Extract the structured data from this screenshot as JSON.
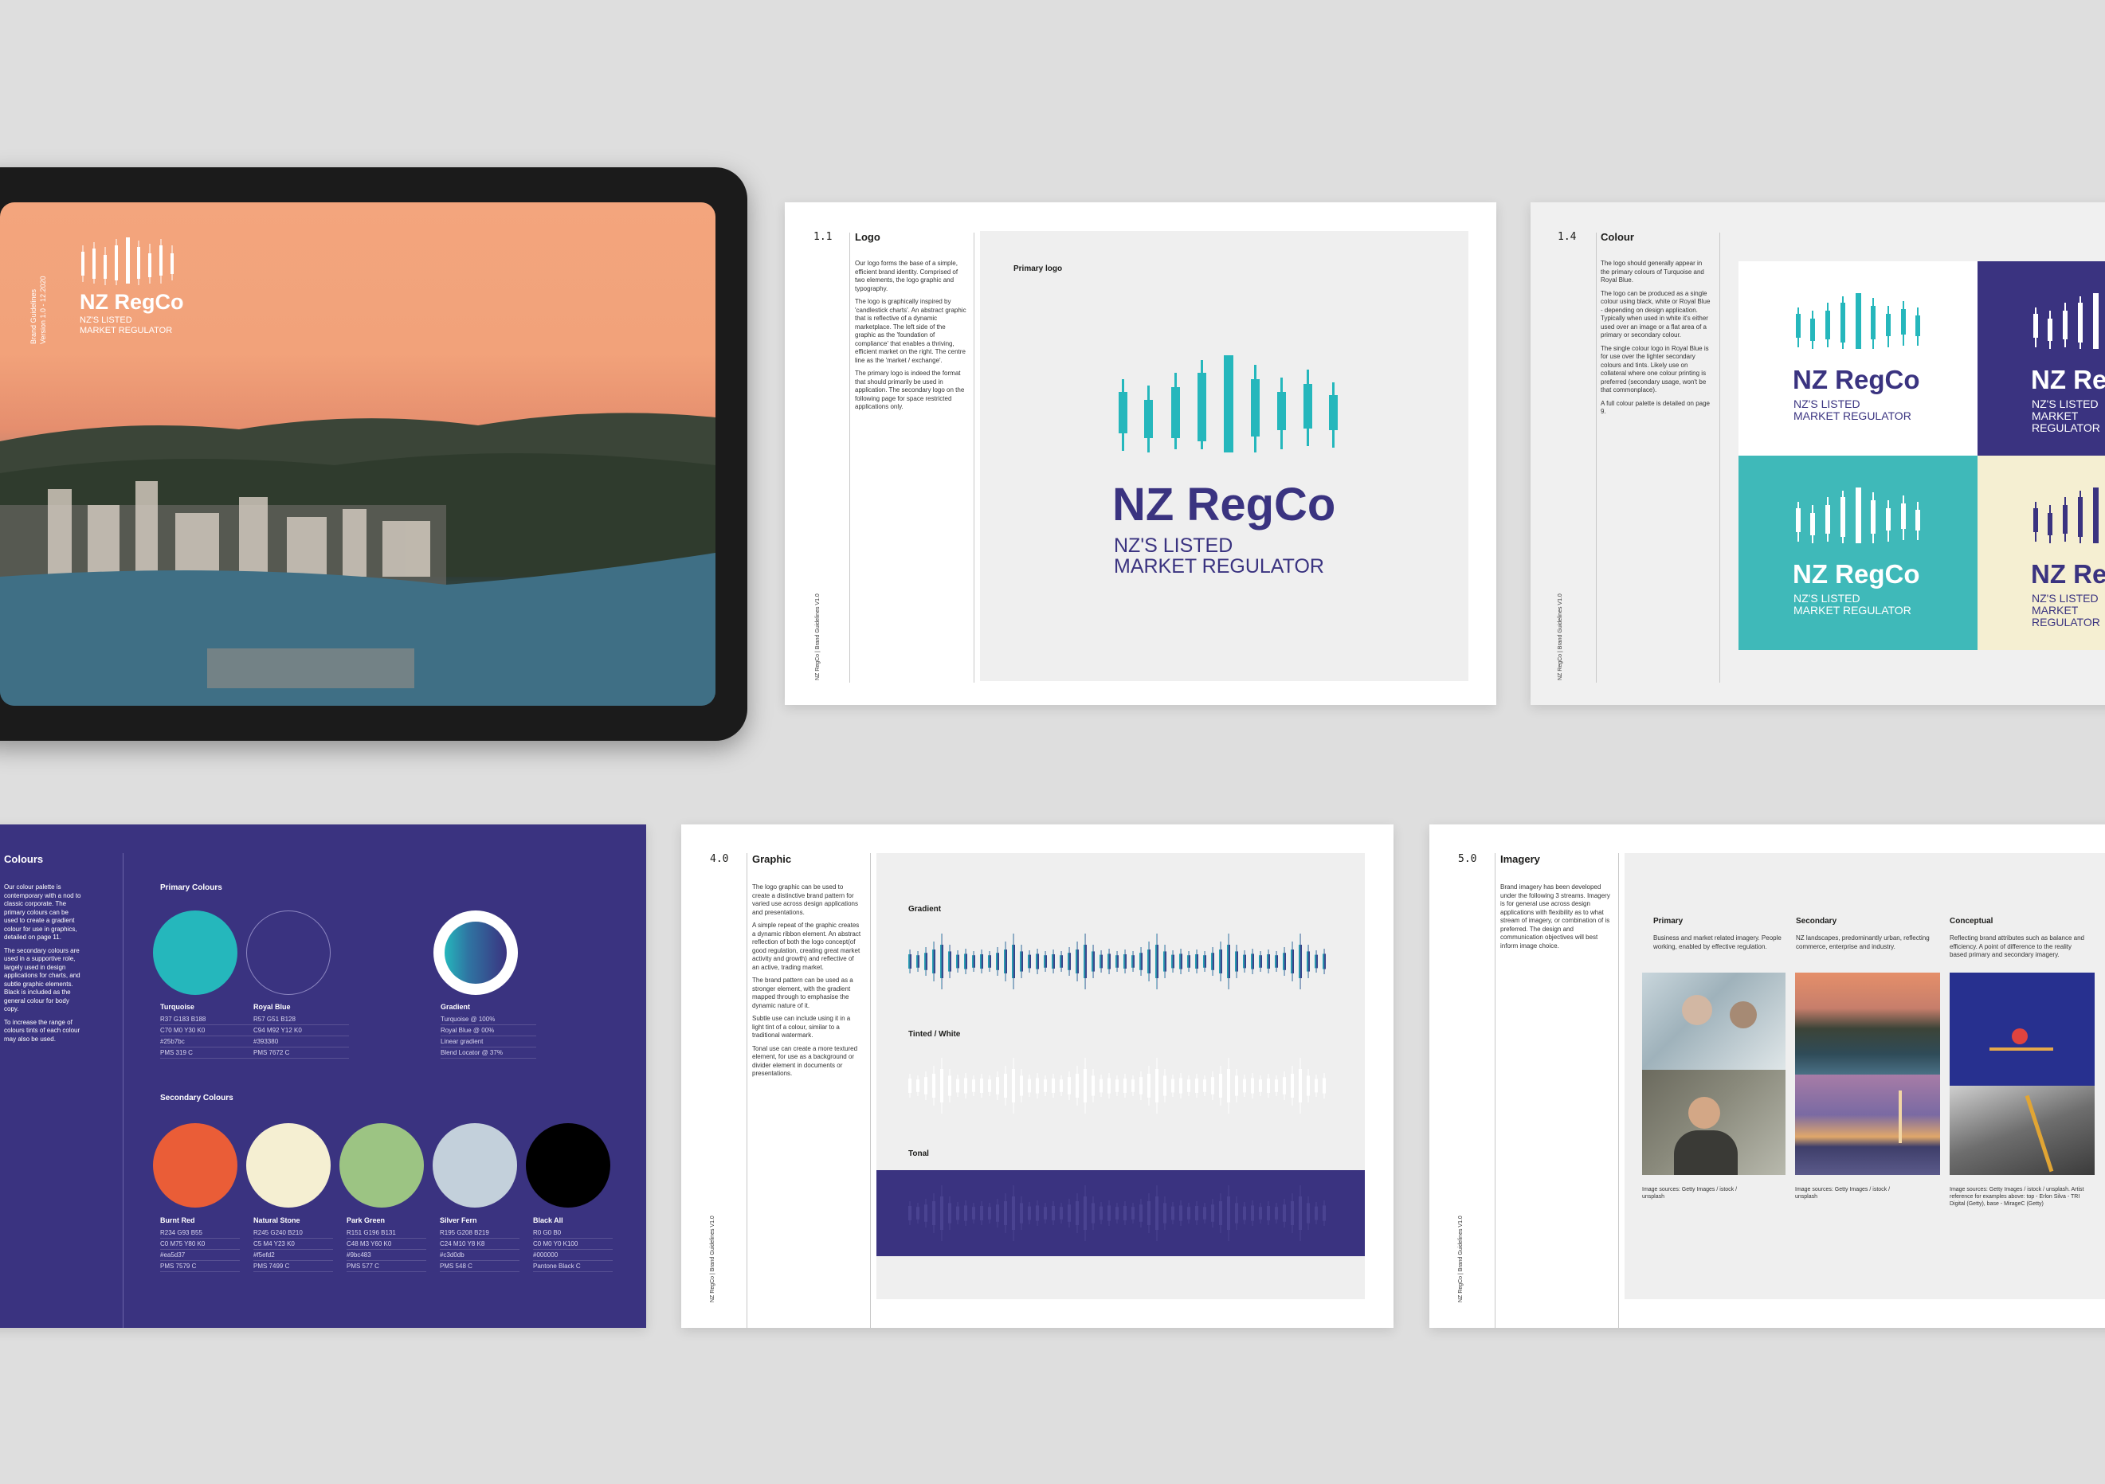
{
  "brand": {
    "name": "NZ RegCo",
    "tagline": "NZ'S LISTED\nMARKET REGULATOR",
    "footer": "NZ RegCo  |  Brand Guidelines V1.0"
  },
  "colors": {
    "turquoise": "#25b7bc",
    "royal_blue": "#3a3380",
    "burnt_red": "#ea5d37",
    "natural_stone": "#f5efd2",
    "park_green": "#9cc483",
    "silver_fern": "#c3d0db",
    "black": "#000000"
  },
  "tablet": {
    "side_text": "Brand Guidelines\nVersion 1.0 - 12.2020"
  },
  "logo_page": {
    "number": "1.1",
    "title": "Logo",
    "paragraphs": [
      "Our logo forms the base of a simple, efficient brand identity. Comprised of two elements, the logo graphic and typography.",
      "The logo is graphically inspired by 'candlestick charts'. An abstract graphic that is reflective of a dynamic marketplace. The left side of the graphic as the 'foundation of compliance' that enables a thriving, efficient market on the right. The centre line as the 'market / exchange'.",
      "The primary logo is indeed the format that should primarily be used in application. The secondary logo on the following page for space restricted applications only."
    ],
    "panel_label": "Primary logo"
  },
  "colour_logo_page": {
    "number": "1.4",
    "title": "Colour",
    "paragraphs": [
      "The logo should generally appear in the primary colours of Turquoise and Royal Blue.",
      "The logo can be produced as a single colour using black, white or Royal Blue - depending on design application. Typically when used in white it's either used over an image or a flat area of a primary or secondary colour.",
      "The single colour logo in Royal Blue is for use over the lighter secondary colours and tints. Likely use on collateral where one colour printing is preferred (secondary usage, won't be that commonplace).",
      "A full colour palette is detailed on page 9."
    ],
    "tile_wordmark_cut": "NZ Re",
    "tile_tag_cut": "NZ'S LISTED\nMARKET REGULATOR"
  },
  "colours_page": {
    "title": "Colours",
    "paragraphs": [
      "Our colour palette is contemporary with a nod to classic corporate. The primary colours can be used to create a gradient colour for use in graphics, detailed on page 11.",
      "The secondary colours are used in a supportive role, largely used in design applications for charts, and subtle graphic elements. Black is included as the general colour for body copy.",
      "To increase the range of colours tints of each colour may also be used."
    ],
    "primary_heading": "Primary Colours",
    "secondary_heading": "Secondary Colours",
    "primary": [
      {
        "name": "Turquoise",
        "specs": [
          "R37 G183 B188",
          "C70 M0 Y30 K0",
          "#25b7bc",
          "PMS 319 C"
        ]
      },
      {
        "name": "Royal Blue",
        "specs": [
          "R57 G51 B128",
          "C94 M92 Y12 K0",
          "#393380",
          "PMS 7672 C"
        ]
      },
      {
        "name": "Gradient",
        "specs": [
          "Turquoise @ 100%",
          "Royal Blue @ 00%",
          "Linear gradient",
          "Blend Locator @ 37%"
        ]
      }
    ],
    "secondary": [
      {
        "name": "Burnt Red",
        "specs": [
          "R234 G93 B55",
          "C0 M75 Y80 K0",
          "#ea5d37",
          "PMS 7579 C"
        ]
      },
      {
        "name": "Natural Stone",
        "specs": [
          "R245 G240 B210",
          "C5 M4 Y23 K0",
          "#f5efd2",
          "PMS 7499 C"
        ]
      },
      {
        "name": "Park Green",
        "specs": [
          "R151 G196 B131",
          "C48 M3 Y60 K0",
          "#9bc483",
          "PMS 577 C"
        ]
      },
      {
        "name": "Silver Fern",
        "specs": [
          "R195 G208 B219",
          "C24 M10 Y8 K8",
          "#c3d0db",
          "PMS 548 C"
        ]
      },
      {
        "name": "Black All",
        "specs": [
          "R0 G0 B0",
          "C0 M0 Y0 K100",
          "#000000",
          "Pantone Black C"
        ]
      }
    ]
  },
  "graphic_page": {
    "number": "4.0",
    "title": "Graphic",
    "paragraphs": [
      "The logo graphic can be used to create a distinctive brand pattern for varied use across design applications and presentations.",
      "A simple repeat of the graphic creates a dynamic ribbon element. An abstract reflection of both the logo concept(of good regulation, creating great market activity and growth) and reflective of an active, trading market.",
      "The brand pattern can be used as a stronger element, with the gradient mapped through to emphasise the dynamic nature of it.",
      "Subtle use can include using it in a light tint of a colour, similar to a traditional watermark.",
      "Tonal use can create a more textured element, for use as a background or divider element in documents or presentations."
    ],
    "labels": {
      "gradient": "Gradient",
      "tinted": "Tinted / White",
      "tonal": "Tonal"
    }
  },
  "imagery_page": {
    "number": "5.0",
    "title": "Imagery",
    "paragraphs": [
      "Brand imagery has been developed under the following 3 streams. Imagery is for general use across design applications with flexibility as to what stream of imagery, or combination of is preferred. The design and communication objectives will best inform image choice."
    ],
    "columns": [
      {
        "heading": "Primary",
        "text": "Business and market related imagery. People working, enabled by effective regulation.",
        "source": "Image sources: Getty Images / istock / unsplash"
      },
      {
        "heading": "Secondary",
        "text": "NZ landscapes, predominantly urban, reflecting commerce, enterprise and industry.",
        "source": "Image sources: Getty Images / istock / unsplash"
      },
      {
        "heading": "Conceptual",
        "text": "Reflecting brand attributes such as balance and efficiency. A point of difference to the reality based primary and secondary imagery.",
        "source": "Image sources: Getty Images / istock / unsplash. Artist reference for examples above: top - Erlon Silva - TRI Digital (Getty), base - MirageC (Getty)"
      }
    ]
  }
}
